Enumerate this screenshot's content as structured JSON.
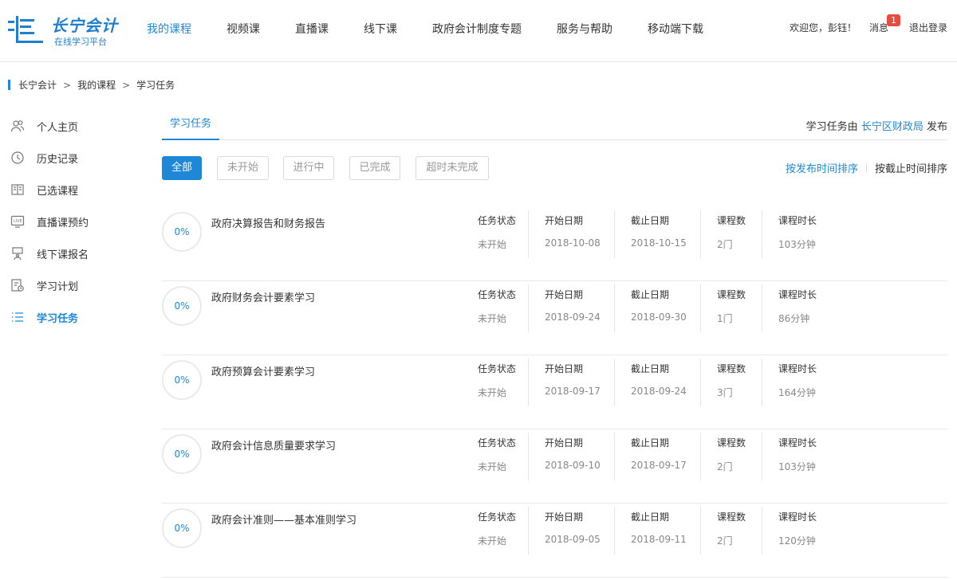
{
  "header": {
    "logo_title": "长宁会计",
    "logo_sub": "在线学习平台",
    "nav": [
      {
        "label": "我的课程",
        "active": true
      },
      {
        "label": "视频课",
        "active": false
      },
      {
        "label": "直播课",
        "active": false
      },
      {
        "label": "线下课",
        "active": false
      },
      {
        "label": "政府会计制度专题",
        "active": false
      },
      {
        "label": "服务与帮助",
        "active": false
      },
      {
        "label": "移动端下载",
        "active": false
      }
    ],
    "welcome": "欢迎您，彭钰！",
    "message_label": "消息",
    "message_count": "1",
    "logout": "退出登录"
  },
  "breadcrumb": {
    "items": [
      "长宁会计",
      "我的课程",
      "学习任务"
    ],
    "separator": ">"
  },
  "sidebar": {
    "items": [
      {
        "label": "个人主页",
        "icon": "users-icon"
      },
      {
        "label": "历史记录",
        "icon": "clock-icon"
      },
      {
        "label": "已选课程",
        "icon": "book-icon"
      },
      {
        "label": "直播课预约",
        "icon": "live-icon"
      },
      {
        "label": "线下课报名",
        "icon": "classroom-icon"
      },
      {
        "label": "学习计划",
        "icon": "plan-icon"
      },
      {
        "label": "学习任务",
        "icon": "list-icon",
        "active": true
      }
    ]
  },
  "main": {
    "tab": "学习任务",
    "publisher_prefix": "学习任务由",
    "publisher_org": "长宁区财政局",
    "publisher_suffix": "发布",
    "filters": [
      "全部",
      "未开始",
      "进行中",
      "已完成",
      "超时未完成"
    ],
    "active_filter": "全部",
    "sort_by_publish": "按发布时间排序",
    "sort_by_deadline": "按截止时间排序",
    "columns": {
      "status": "任务状态",
      "start": "开始日期",
      "end": "截止日期",
      "count": "课程数",
      "duration": "课程时长"
    },
    "tasks": [
      {
        "progress": "0%",
        "name": "政府决算报告和财务报告",
        "status": "未开始",
        "start": "2018-10-08",
        "end": "2018-10-15",
        "count": "2门",
        "duration": "103分钟"
      },
      {
        "progress": "0%",
        "name": "政府财务会计要素学习",
        "status": "未开始",
        "start": "2018-09-24",
        "end": "2018-09-30",
        "count": "1门",
        "duration": "86分钟"
      },
      {
        "progress": "0%",
        "name": "政府预算会计要素学习",
        "status": "未开始",
        "start": "2018-09-17",
        "end": "2018-09-24",
        "count": "3门",
        "duration": "164分钟"
      },
      {
        "progress": "0%",
        "name": "政府会计信息质量要求学习",
        "status": "未开始",
        "start": "2018-09-10",
        "end": "2018-09-17",
        "count": "2门",
        "duration": "103分钟"
      },
      {
        "progress": "0%",
        "name": "政府会计准则——基本准则学习",
        "status": "未开始",
        "start": "2018-09-05",
        "end": "2018-09-11",
        "count": "2门",
        "duration": "120分钟"
      }
    ]
  },
  "colors": {
    "accent": "#1e88d6",
    "badge": "#e84c3d"
  }
}
